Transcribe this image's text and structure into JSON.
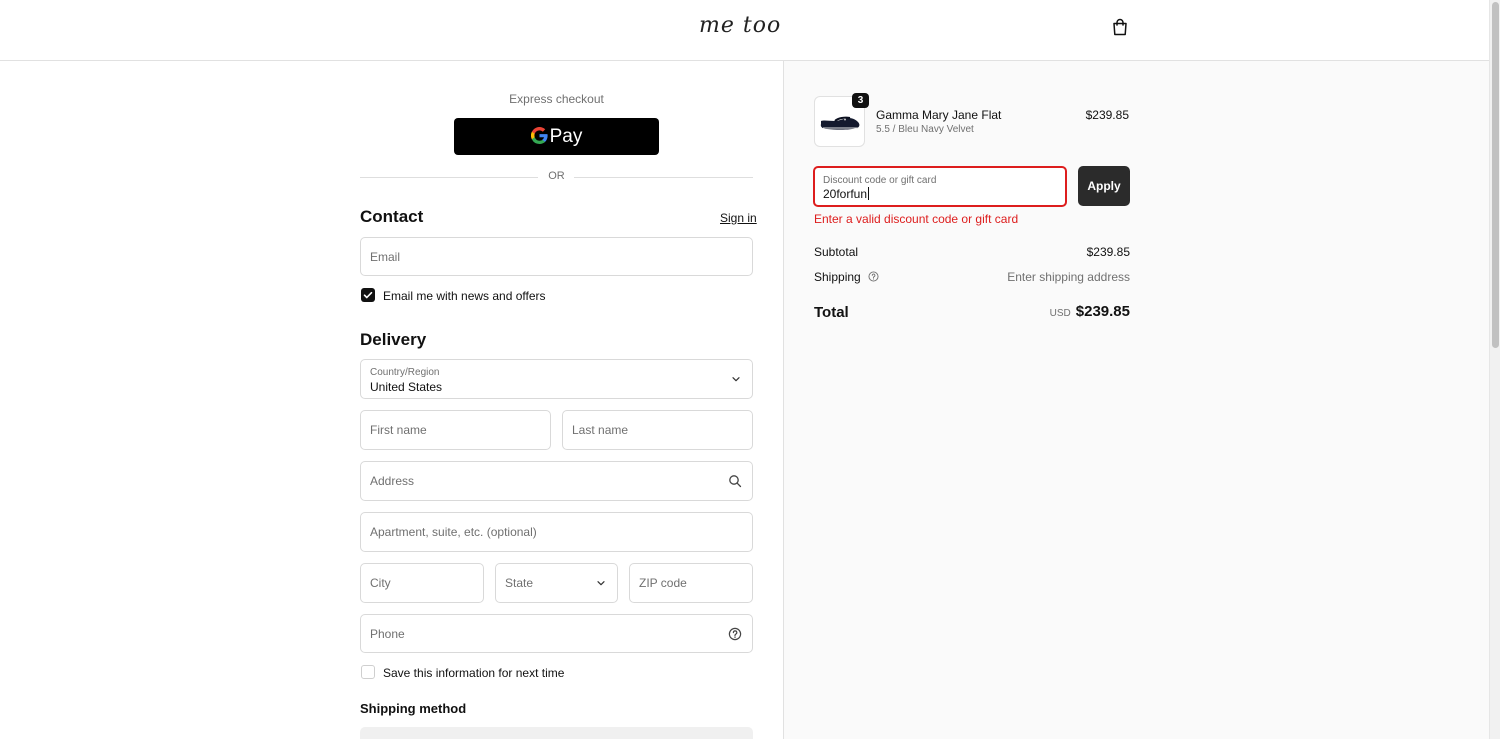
{
  "header": {
    "logo_text": "me too",
    "icons": {
      "bag": "shopping-bag-icon"
    }
  },
  "express": {
    "label": "Express checkout",
    "gpay_g": "G",
    "gpay_label": "Pay"
  },
  "divider": {
    "or_text": "OR"
  },
  "contact": {
    "title": "Contact",
    "signin_label": "Sign in",
    "email_placeholder": "Email",
    "newsletter_label": "Email me with news and offers",
    "newsletter_checked": true
  },
  "delivery": {
    "title": "Delivery",
    "country_label": "Country/Region",
    "country_value": "United States",
    "first_name_placeholder": "First name",
    "last_name_placeholder": "Last name",
    "address_placeholder": "Address",
    "apartment_placeholder": "Apartment, suite, etc. (optional)",
    "city_placeholder": "City",
    "state_placeholder": "State",
    "zip_placeholder": "ZIP code",
    "phone_placeholder": "Phone",
    "save_info_label": "Save this information for next time",
    "save_info_checked": false
  },
  "shipping_method": {
    "title": "Shipping method"
  },
  "order": {
    "item": {
      "quantity": "3",
      "name": "Gamma Mary Jane Flat",
      "variant": "5.5 / Bleu Navy Velvet",
      "price": "$239.85"
    },
    "discount": {
      "label": "Discount code or gift card",
      "value": "20forfun",
      "apply_label": "Apply",
      "error": "Enter a valid discount code or gift card"
    },
    "subtotal_label": "Subtotal",
    "subtotal_value": "$239.85",
    "shipping_label": "Shipping",
    "shipping_value": "Enter shipping address",
    "total_label": "Total",
    "total_currency": "USD",
    "total_value": "$239.85"
  },
  "colors": {
    "error": "#dd1d1d",
    "button_dark": "#2b2b2b",
    "border": "#d9d9d9",
    "muted_text": "#707070"
  }
}
